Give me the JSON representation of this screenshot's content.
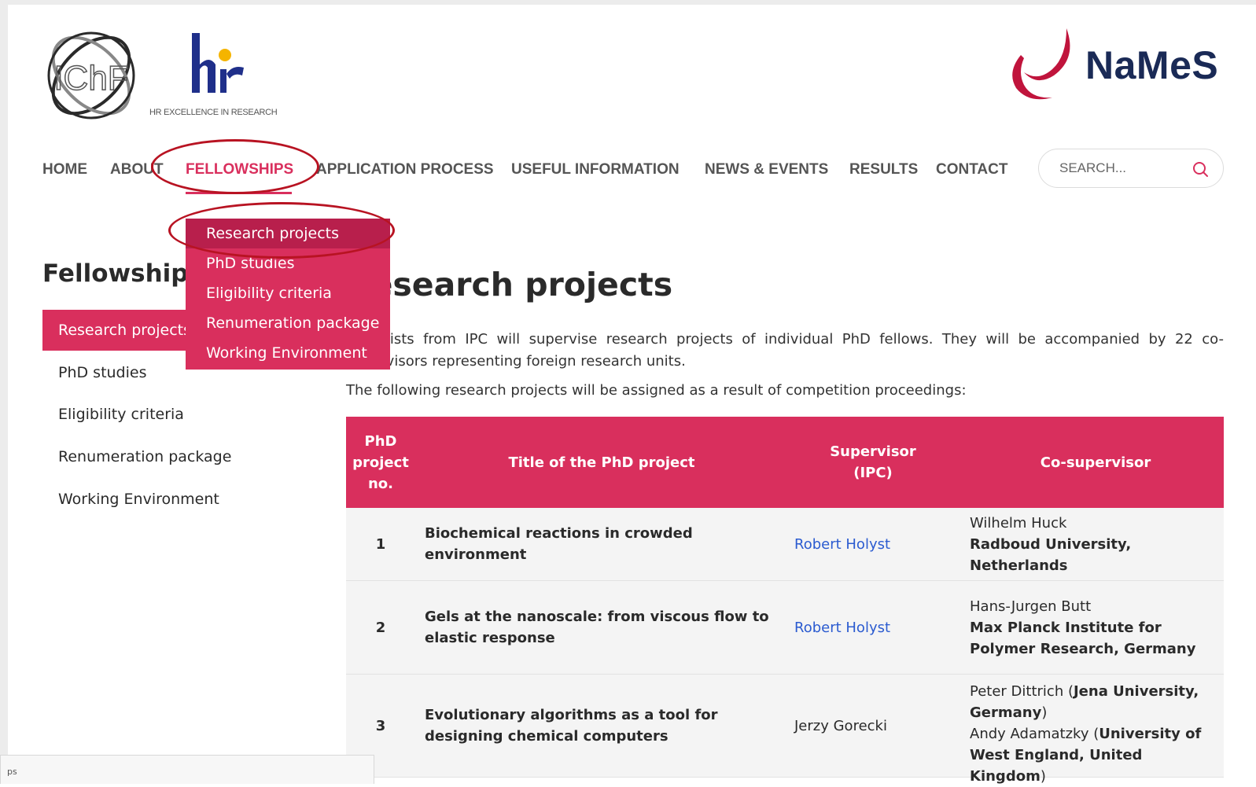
{
  "logos": {
    "ichf_icon": "ichf-logo",
    "hr_icon": "hr-excellence-logo",
    "hr_caption": "HR EXCELLENCE IN RESEARCH",
    "names_icon": "names-logo",
    "names_text": "NaMeS",
    "ichf_colors": [
      "#2a2a2a",
      "#888888"
    ],
    "hr_colors": [
      "#1f2f8a",
      "#f5b400"
    ],
    "names_colors": [
      "#c0143c",
      "#1a2a56"
    ]
  },
  "nav": {
    "items": [
      {
        "label": "HOME"
      },
      {
        "label": "ABOUT"
      },
      {
        "label": "FELLOWSHIPS"
      },
      {
        "label": "APPLICATION PROCESS"
      },
      {
        "label": "USEFUL INFORMATION"
      },
      {
        "label": "NEWS & EVENTS"
      },
      {
        "label": "RESULTS"
      },
      {
        "label": "CONTACT"
      }
    ],
    "active": "FELLOWSHIPS"
  },
  "search": {
    "placeholder": "SEARCH...",
    "icon": "search-icon"
  },
  "dropdown": {
    "items": [
      {
        "label": "Research projects"
      },
      {
        "label": "PhD studies"
      },
      {
        "label": "Eligibility criteria"
      },
      {
        "label": "Renumeration package"
      },
      {
        "label": "Working Environment"
      }
    ],
    "active": "Research projects"
  },
  "sidebar": {
    "title": "Fellowships",
    "items": [
      {
        "label": "Research projects"
      },
      {
        "label": "PhD studies"
      },
      {
        "label": "Eligibility criteria"
      },
      {
        "label": "Renumeration package"
      },
      {
        "label": "Working Environment"
      }
    ],
    "active": "Research projects"
  },
  "main": {
    "title": "Research projects",
    "intro": "Scientists from IPC will supervise research projects of individual PhD fellows. They will be accompanied by 22 co-supervisors representing foreign research units.",
    "lead": "The following research projects will be assigned as a result of competition proceedings:"
  },
  "table": {
    "headers": [
      "PhD project no.",
      "Title of the PhD project",
      "Supervisor (IPC)",
      "Co-supervisor"
    ],
    "rows": [
      {
        "no": "1",
        "title": "Biochemical reactions in crowded environment",
        "supervisor": "Robert Holyst",
        "supervisor_is_link": true,
        "cosupervisor_name": "Wilhelm Huck",
        "cosupervisor_institution": "Radboud University, Netherlands"
      },
      {
        "no": "2",
        "title": "Gels at the nanoscale: from viscous flow to elastic response",
        "supervisor": "Robert Holyst",
        "supervisor_is_link": true,
        "cosupervisor_name": "Hans-Jurgen Butt",
        "cosupervisor_institution": "Max Planck Institute for Polymer Research, Germany"
      },
      {
        "no": "3",
        "title": "Evolutionary algorithms as a tool for designing chemical computers",
        "supervisor": "Jerzy Gorecki",
        "supervisor_is_link": false,
        "cosupervisors": [
          {
            "name": "Peter Dittrich",
            "institution": "Jena University, Germany"
          },
          {
            "name": "Andy Adamatzky",
            "institution": "University of West England, United Kingdom"
          }
        ]
      }
    ]
  },
  "status_bar": {
    "text": "ps"
  },
  "colors": {
    "accent": "#d92f5d",
    "accent_dark": "#b81f4c",
    "annotation": "#b81322",
    "link": "#2b5bd0",
    "text": "#2a2a2a"
  }
}
